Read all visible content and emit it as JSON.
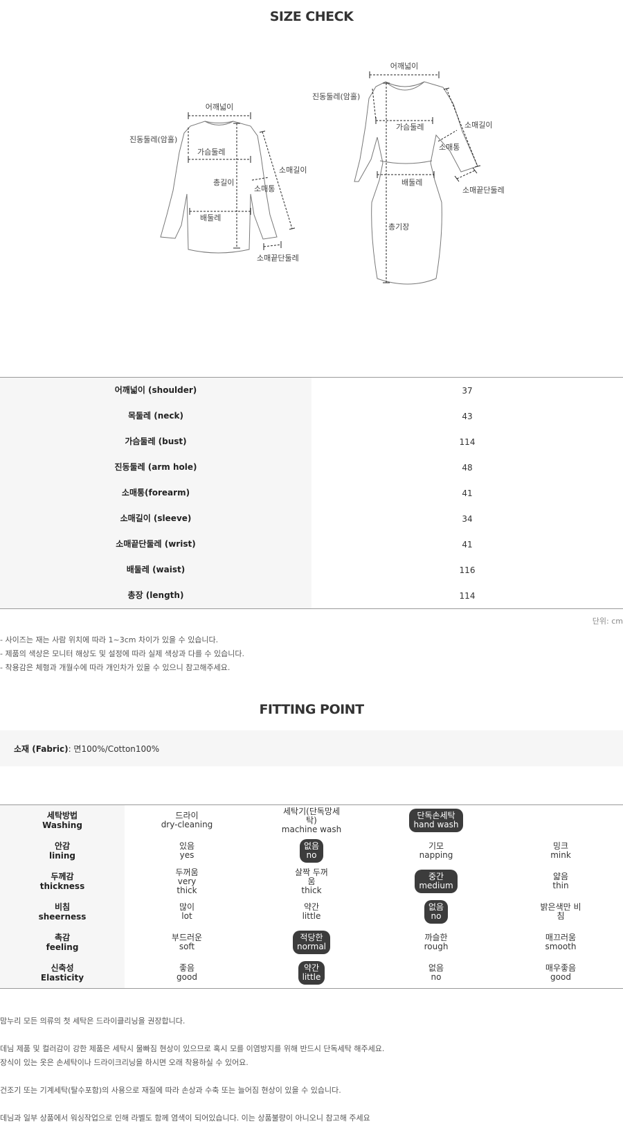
{
  "size_check": {
    "title": "SIZE CHECK",
    "diagram_labels": {
      "left": {
        "shoulder": "어깨넓이",
        "armhole": "진동둘레(암홀)",
        "bust": "가슴둘레",
        "length": "총길이",
        "sleeve": "소매길이",
        "forearm": "소매통",
        "waist": "배둘레",
        "wrist": "소매끝단둘레"
      },
      "right": {
        "shoulder": "어깨넓이",
        "armhole": "진동둘레(암홀)",
        "bust": "가슴둘레",
        "sleeve": "소매길이",
        "forearm": "소매통",
        "wrist": "소매끝단둘레",
        "waist": "배둘레",
        "length": "총기장"
      }
    },
    "rows": [
      {
        "label": "어깨넓이 (shoulder)",
        "value": "37"
      },
      {
        "label": "목둘레 (neck)",
        "value": "43"
      },
      {
        "label": "가슴둘레 (bust)",
        "value": "114"
      },
      {
        "label": "진동둘레 (arm hole)",
        "value": "48"
      },
      {
        "label": "소매통(forearm)",
        "value": "41"
      },
      {
        "label": "소매길이 (sleeve)",
        "value": "34"
      },
      {
        "label": "소매끝단둘레 (wrist)",
        "value": "41"
      },
      {
        "label": "배둘레 (waist)",
        "value": "116"
      },
      {
        "label": "총장 (length)",
        "value": "114"
      }
    ],
    "unit": "단위: cm",
    "notes": [
      "- 사이즈는 재는 사람 위치에 따라 1~3cm 차이가 있을 수 있습니다.",
      "- 제품의 색상은 모니터 해상도 및 설정에 따라 실제 색상과 다를 수 있습니다.",
      "- 착용감은 체형과 개월수에 따라 개인차가 있을 수 있으니 참고해주세요."
    ]
  },
  "fitting_point": {
    "title": "FITTING POINT",
    "fabric_label": "소재 (Fabric)",
    "fabric_value": " : 면100%/Cotton100%",
    "rows": [
      {
        "head": [
          "세탁방법",
          "Washing"
        ],
        "options": [
          {
            "lines": [
              "드라이",
              "dry-cleaning"
            ],
            "selected": false
          },
          {
            "lines": [
              "세탁기(단독망세탁)",
              "machine wash"
            ],
            "selected": false
          },
          {
            "lines": [
              "단독손세탁",
              "hand wash"
            ],
            "selected": true
          },
          {
            "lines": [],
            "selected": false
          }
        ]
      },
      {
        "head": [
          "안감",
          "lining"
        ],
        "options": [
          {
            "lines": [
              "있음",
              "yes"
            ],
            "selected": false
          },
          {
            "lines": [
              "없음",
              "no"
            ],
            "selected": true
          },
          {
            "lines": [
              "기모",
              "napping"
            ],
            "selected": false
          },
          {
            "lines": [
              "밍크",
              "mink"
            ],
            "selected": false
          }
        ]
      },
      {
        "head": [
          "두께감",
          "thickness"
        ],
        "options": [
          {
            "lines": [
              "두꺼움",
              "very",
              "thick"
            ],
            "selected": false
          },
          {
            "lines": [
              "살짝 두꺼",
              "움",
              "thick"
            ],
            "selected": false
          },
          {
            "lines": [
              "중간",
              "medium"
            ],
            "selected": true
          },
          {
            "lines": [
              "얇음",
              "thin"
            ],
            "selected": false
          }
        ]
      },
      {
        "head": [
          "비침",
          "sheerness"
        ],
        "options": [
          {
            "lines": [
              "많이",
              "lot"
            ],
            "selected": false
          },
          {
            "lines": [
              "약간",
              "little"
            ],
            "selected": false
          },
          {
            "lines": [
              "없음",
              "no"
            ],
            "selected": true
          },
          {
            "lines": [
              "밝은색만 비",
              "침"
            ],
            "selected": false
          }
        ]
      },
      {
        "head": [
          "촉감",
          "feeling"
        ],
        "options": [
          {
            "lines": [
              "부드러운",
              "soft"
            ],
            "selected": false
          },
          {
            "lines": [
              "적당한",
              "normal"
            ],
            "selected": true
          },
          {
            "lines": [
              "까슬한",
              "rough"
            ],
            "selected": false
          },
          {
            "lines": [
              "매끄러움",
              "smooth"
            ],
            "selected": false
          }
        ]
      },
      {
        "head": [
          "신축성",
          "Elasticity"
        ],
        "options": [
          {
            "lines": [
              "좋음",
              "good"
            ],
            "selected": false
          },
          {
            "lines": [
              "약간",
              "little"
            ],
            "selected": true
          },
          {
            "lines": [
              "없음",
              "no"
            ],
            "selected": false
          },
          {
            "lines": [
              "매우좋음",
              "good"
            ],
            "selected": false
          }
        ]
      }
    ],
    "care_notes": [
      [
        "맘누리 모든 의류의 첫 세탁은 드라이클리닝을 권장합니다."
      ],
      [
        "데님 제품 및 컬러감이 강한 제품은 세탁시 물빠짐 현상이 있으므로 혹시 모를 이염방지를 위해 반드시 단독세탁 해주세요.",
        "장식이 있는 옷은 손세탁이나 드라이크리닝을 하시면 오래 착용하실 수 있어요."
      ],
      [
        "건조기 또는 기계세탁(탈수포함)의 사용으로 재질에 따라 손상과 수축 또는 늘어짐 현상이 있을 수 있습니다."
      ],
      [
        "데님과 일부 상품에서 워싱작업으로 인해 라벨도 함께 염색이 되어있습니다. 이는 상품불량이 아니오니 참고해 주세요"
      ]
    ]
  }
}
